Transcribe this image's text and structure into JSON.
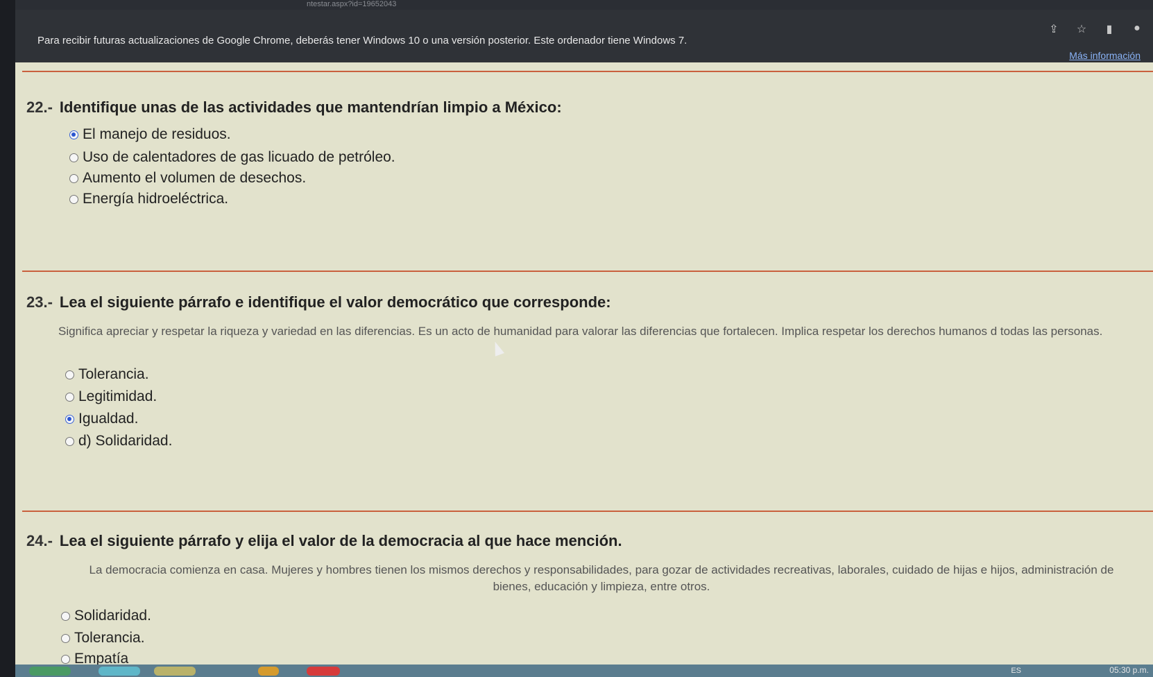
{
  "browser": {
    "url_fragment": "ntestar.aspx?id=19652043",
    "warning_message": "Para recibir futuras actualizaciones de Google Chrome, deberás tener Windows 10 o una versión posterior. Este ordenador tiene Windows 7.",
    "more_info_link": "Más información",
    "icons": [
      "share-icon",
      "star-icon",
      "sidepanel-icon",
      "profile-icon"
    ]
  },
  "questions": [
    {
      "number": "22.-",
      "title": "Identifique unas de las actividades que mantendrían limpio a México:",
      "paragraph": "",
      "options": [
        {
          "label": "El manejo de residuos.",
          "selected": true
        },
        {
          "label": "Uso de calentadores de gas licuado de petróleo.",
          "selected": false
        },
        {
          "label": "Aumento el volumen de desechos.",
          "selected": false
        },
        {
          "label": "Energía hidroeléctrica.",
          "selected": false
        }
      ]
    },
    {
      "number": "23.-",
      "title": "Lea el siguiente párrafo e identifique el valor democrático que corresponde:",
      "paragraph": "Significa apreciar y respetar la riqueza y variedad en las diferencias. Es un acto de humanidad para valorar las diferencias que fortalecen. Implica respetar los derechos humanos d todas las personas.",
      "options": [
        {
          "label": "Tolerancia.",
          "selected": false
        },
        {
          "label": "Legitimidad.",
          "selected": false
        },
        {
          "label": "Igualdad.",
          "selected": true
        },
        {
          "label": "d) Solidaridad.",
          "selected": false
        }
      ]
    },
    {
      "number": "24.-",
      "title": "Lea el siguiente párrafo y elija el valor de la democracia al que hace mención.",
      "paragraph": "La democracia comienza en casa. Mujeres y hombres tienen los mismos derechos y responsabilidades, para gozar de actividades recreativas, laborales, cuidado de hijas e hijos, administración de bienes, educación y limpieza, entre otros.",
      "options": [
        {
          "label": "Solidaridad.",
          "selected": false
        },
        {
          "label": "Tolerancia.",
          "selected": false
        },
        {
          "label": "Empatía",
          "selected": false
        }
      ]
    }
  ],
  "taskbar": {
    "language": "ES",
    "time": "05:30 p.m."
  },
  "colors": {
    "selected_radio": "#2a55d1",
    "divider": "#c9603d",
    "page_background": "#e2e2cc"
  }
}
